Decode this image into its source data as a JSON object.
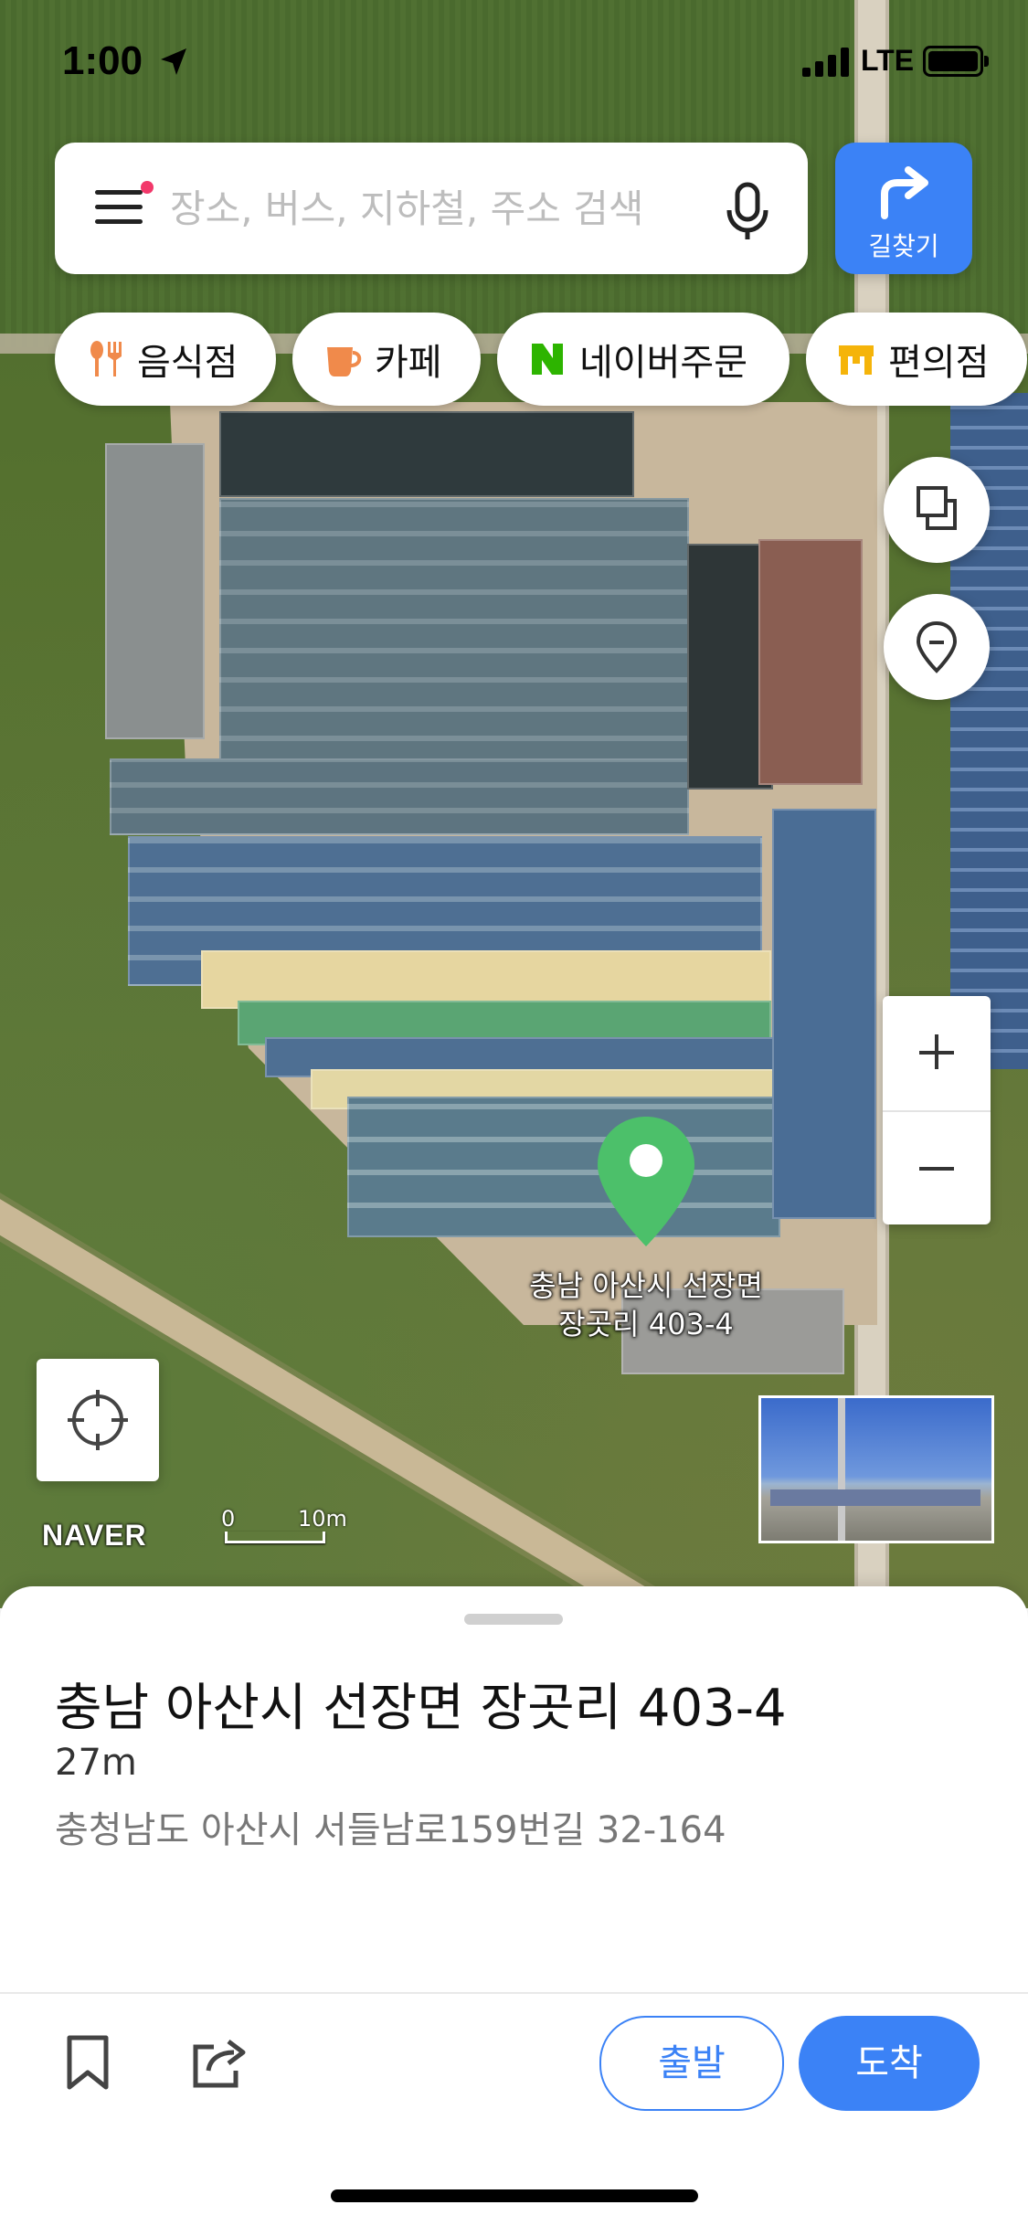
{
  "status_bar": {
    "time": "1:00",
    "network": "LTE"
  },
  "search": {
    "placeholder": "장소, 버스, 지하철, 주소 검색"
  },
  "route_button": {
    "label": "길찾기"
  },
  "chips": [
    {
      "label": "음식점",
      "icon": "restaurant-icon",
      "color": "#f08a4b"
    },
    {
      "label": "카페",
      "icon": "cafe-icon",
      "color": "#f08a4b"
    },
    {
      "label": "네이버주문",
      "icon": "naver-n-icon",
      "color": "#2db400"
    },
    {
      "label": "편의점",
      "icon": "convenience-store-icon",
      "color": "#f5b40a"
    }
  ],
  "map": {
    "brand": "NAVER",
    "scale": {
      "zero": "0",
      "label": "10m"
    },
    "pin_label_line1": "충남 아산시 선장면",
    "pin_label_line2": "장곳리 403-4",
    "pin_color": "#4cc06a"
  },
  "place": {
    "title": "충남 아산시 선장면 장곳리 403-4",
    "distance": "27m",
    "road_address": "충청남도 아산시 서들남로159번길 32-164"
  },
  "actions": {
    "start": "출발",
    "arrive": "도착",
    "accent": "#3b82f6"
  }
}
